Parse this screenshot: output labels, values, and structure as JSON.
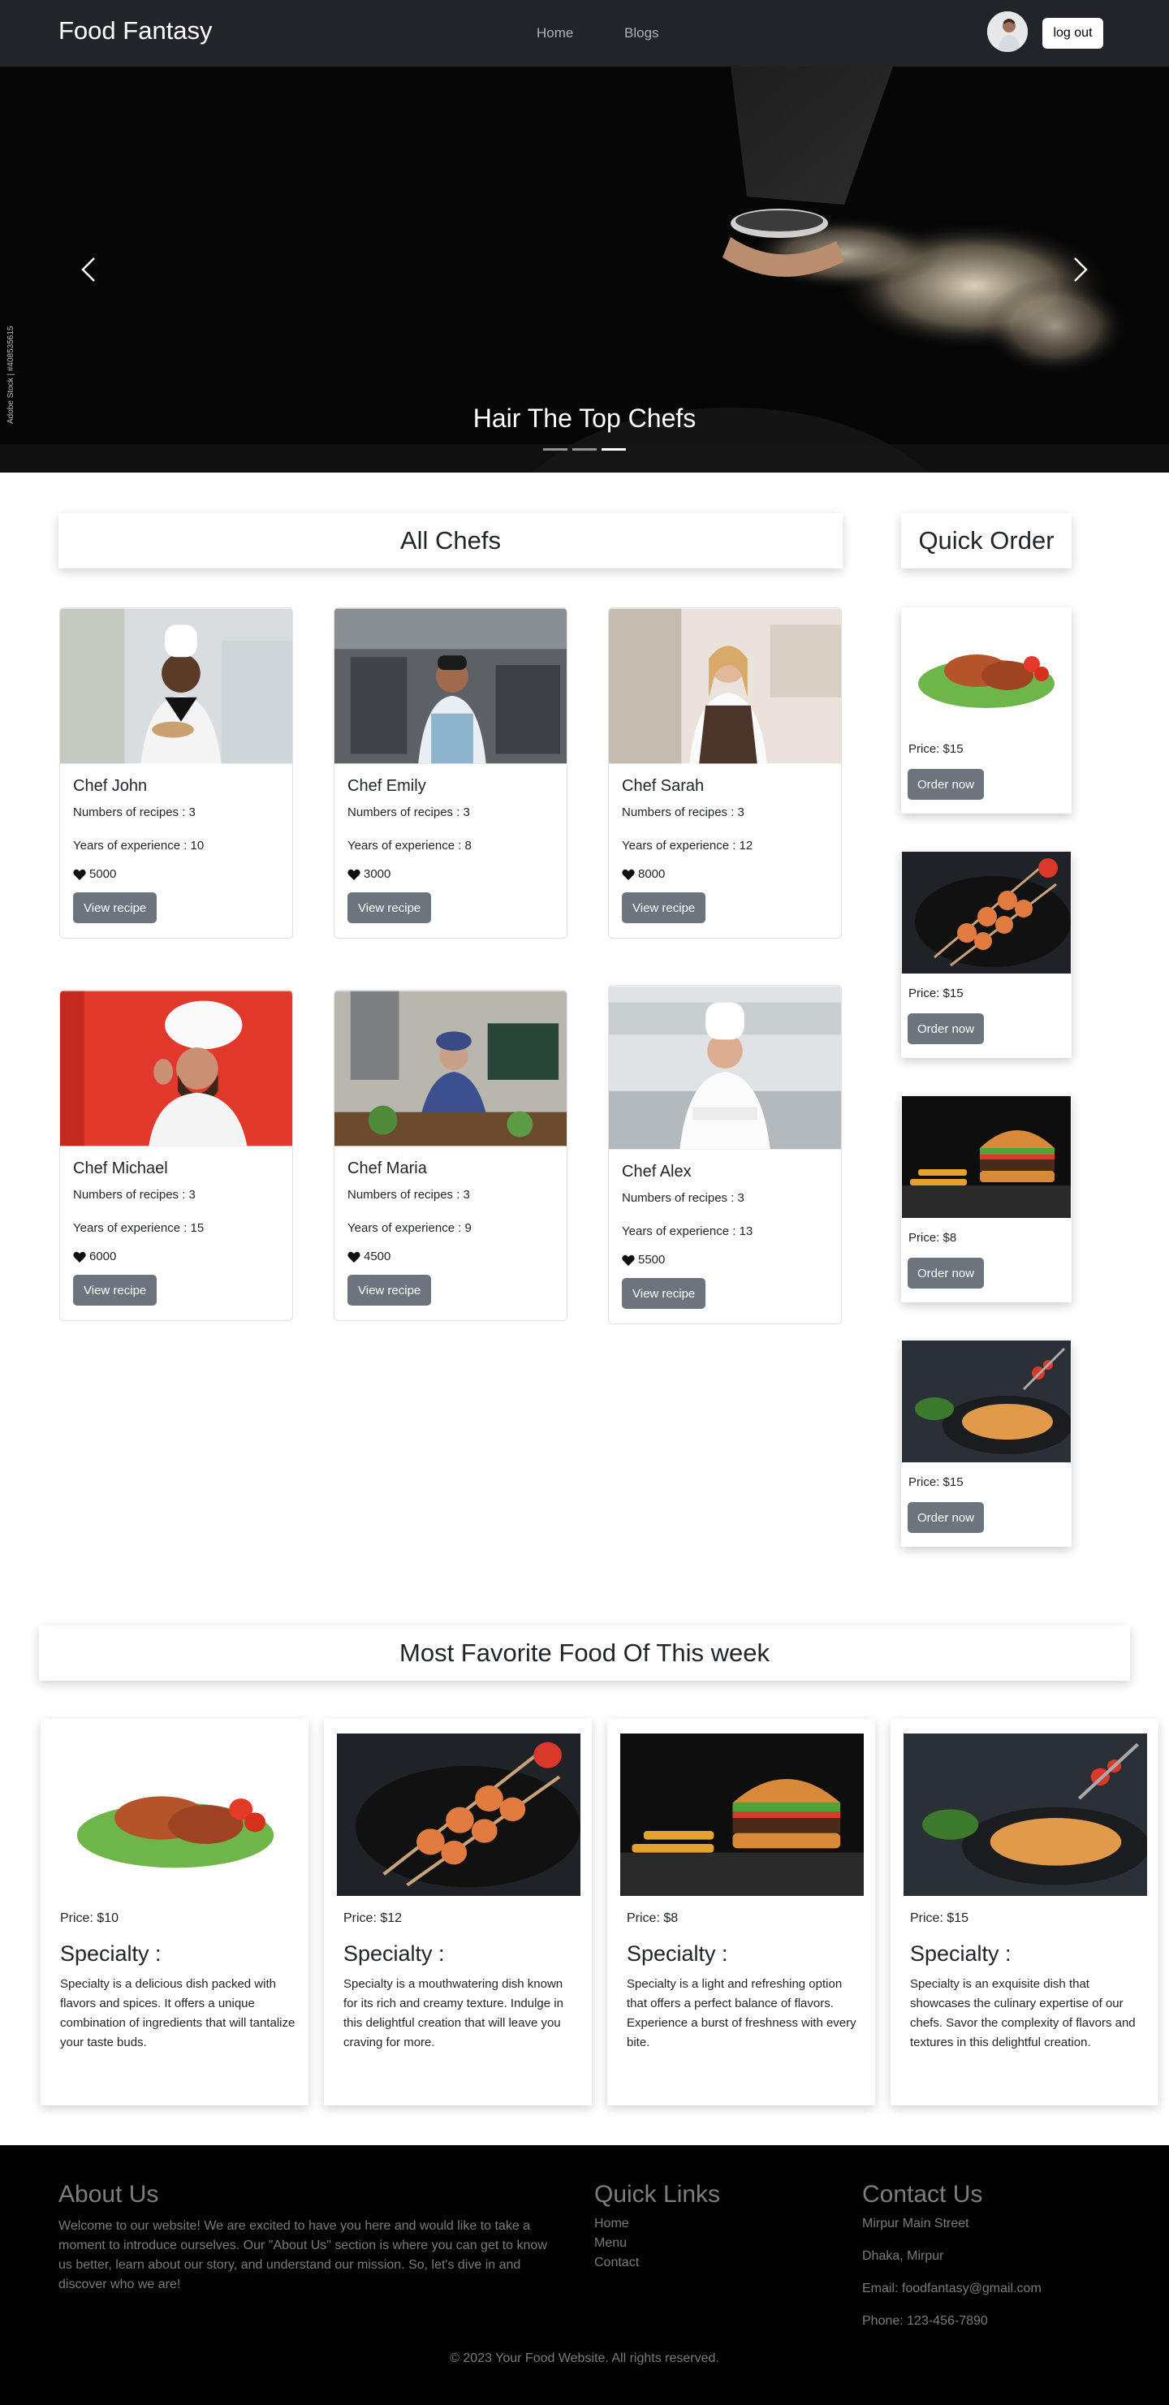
{
  "navbar": {
    "brand": "Food Fantasy",
    "links": [
      "Home",
      "Blogs"
    ],
    "logout_label": "log out"
  },
  "hero": {
    "caption": "Hair The Top Chefs",
    "watermark_side": "Adobe Stock | #408535615",
    "watermark": "Adobe Stock",
    "slide_count": 3,
    "active_slide": 3
  },
  "chefs": {
    "heading": "All Chefs",
    "items": [
      {
        "name": "Chef John",
        "recipes": "Numbers of recipes : 3",
        "experience": "Years of experience : 10",
        "likes": "5000",
        "button": "View recipe"
      },
      {
        "name": "Chef Emily",
        "recipes": "Numbers of recipes : 3",
        "experience": "Years of experience : 8",
        "likes": "3000",
        "button": "View recipe"
      },
      {
        "name": "Chef Sarah",
        "recipes": "Numbers of recipes : 3",
        "experience": "Years of experience : 12",
        "likes": "8000",
        "button": "View recipe"
      },
      {
        "name": "Chef Michael",
        "recipes": "Numbers of recipes : 3",
        "experience": "Years of experience : 15",
        "likes": "6000",
        "button": "View recipe"
      },
      {
        "name": "Chef Maria",
        "recipes": "Numbers of recipes : 3",
        "experience": "Years of experience : 9",
        "likes": "4500",
        "button": "View recipe"
      },
      {
        "name": "Chef Alex",
        "recipes": "Numbers of recipes : 3",
        "experience": "Years of experience : 13",
        "likes": "5500",
        "button": "View recipe"
      }
    ]
  },
  "quick_order": {
    "heading": "Quick Order",
    "items": [
      {
        "price": "Price: $15",
        "button": "Order now"
      },
      {
        "price": "Price: $15",
        "button": "Order now"
      },
      {
        "price": "Price: $8",
        "button": "Order now"
      },
      {
        "price": "Price: $15",
        "button": "Order now"
      }
    ]
  },
  "favorites": {
    "heading": "Most Favorite Food Of This week",
    "items": [
      {
        "price": "Price: $10",
        "title": "Specialty :",
        "desc": "Specialty is a delicious dish packed with flavors and spices. It offers a unique combination of ingredients that will tantalize your taste buds."
      },
      {
        "price": "Price: $12",
        "title": "Specialty :",
        "desc": "Specialty is a mouthwatering dish known for its rich and creamy texture. Indulge in this delightful creation that will leave you craving for more."
      },
      {
        "price": "Price: $8",
        "title": "Specialty :",
        "desc": "Specialty is a light and refreshing option that offers a perfect balance of flavors. Experience a burst of freshness with every bite."
      },
      {
        "price": "Price: $15",
        "title": "Specialty :",
        "desc": "Specialty is an exquisite dish that showcases the culinary expertise of our chefs. Savor the complexity of flavors and textures in this delightful creation."
      }
    ]
  },
  "footer": {
    "about_title": "About Us",
    "about_text": "Welcome to our website! We are excited to have you here and would like to take a moment to introduce ourselves. Our \"About Us\" section is where you can get to know us better, learn about our story, and understand our mission. So, let's dive in and discover who we are!",
    "links_title": "Quick Links",
    "links": [
      "Home",
      "Menu",
      "Contact"
    ],
    "contact_title": "Contact Us",
    "contact": [
      "Mirpur Main Street",
      "Dhaka, Mirpur",
      "Email: foodfantasy@gmail.com",
      "Phone: 123-456-7890"
    ],
    "copyright": "© 2023 Your Food Website. All rights reserved."
  },
  "colors": {
    "navbar_bg": "#212529",
    "button_gray": "#6c757d",
    "footer_bg": "#000000"
  }
}
